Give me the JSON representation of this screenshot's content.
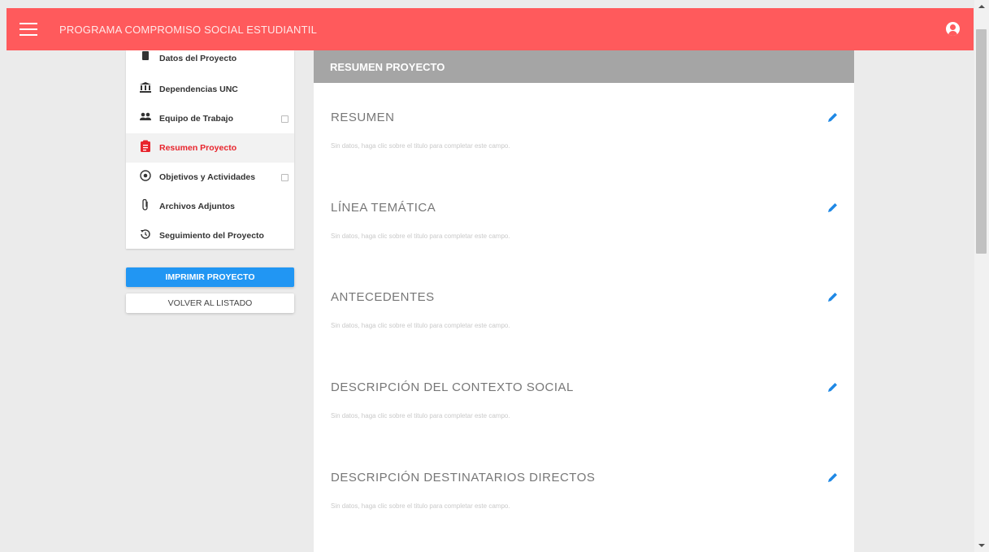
{
  "header": {
    "title": "PROGRAMA COMPROMISO SOCIAL ESTUDIANTIL",
    "background_color": "#ff5a5c",
    "menu_icon": "hamburger-menu-icon",
    "user_icon": "account-circle-icon"
  },
  "sidebar": {
    "items": [
      {
        "label": "Datos del Proyecto",
        "icon": "document-icon",
        "active": false
      },
      {
        "label": "Dependencias UNC",
        "icon": "bank-icon",
        "active": false
      },
      {
        "label": "Equipo de Trabajo",
        "icon": "group-icon",
        "active": false,
        "checkbox": true
      },
      {
        "label": "Resumen Proyecto",
        "icon": "clipboard-icon",
        "active": true
      },
      {
        "label": "Objetivos y Actividades",
        "icon": "target-icon",
        "active": false,
        "checkbox": true
      },
      {
        "label": "Archivos Adjuntos",
        "icon": "paperclip-icon",
        "active": false
      },
      {
        "label": "Seguimiento del Proyecto",
        "icon": "history-icon",
        "active": false
      }
    ],
    "active_color": "#e8242c"
  },
  "actions": {
    "print_label": "IMPRIMIR PROYECTO",
    "back_label": "VOLVER AL LISTADO",
    "print_color": "#2196f3"
  },
  "panel": {
    "title": "RESUMEN PROYECTO",
    "header_color": "#a5a5a5",
    "sections": [
      {
        "title": "RESUMEN",
        "hint": "Sin datos, haga clic sobre el titulo para completar este campo."
      },
      {
        "title": "LÍNEA TEMÁTICA",
        "hint": "Sin datos, haga clic sobre el titulo para completar este campo."
      },
      {
        "title": "ANTECEDENTES",
        "hint": "Sin datos, haga clic sobre el titulo para completar este campo."
      },
      {
        "title": "DESCRIPCIÓN DEL CONTEXTO SOCIAL",
        "hint": "Sin datos, haga clic sobre el titulo para completar este campo."
      },
      {
        "title": "DESCRIPCIÓN DESTINATARIOS DIRECTOS",
        "hint": "Sin datos, haga clic sobre el titulo para completar este campo."
      }
    ],
    "edit_icon": "pencil-icon",
    "edit_color": "#1e88e5"
  }
}
